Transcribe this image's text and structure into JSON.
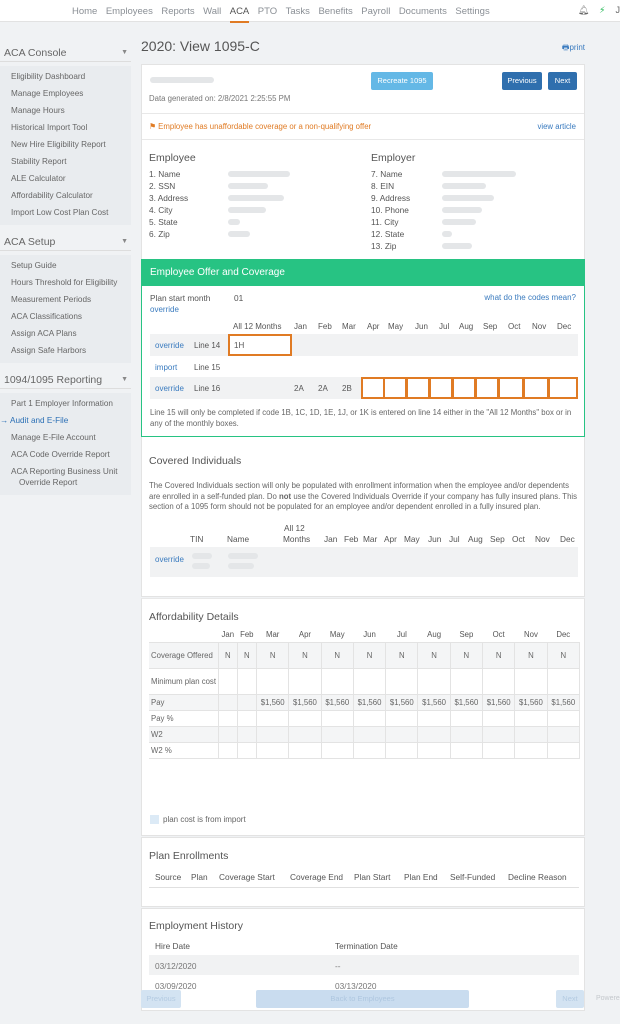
{
  "nav": {
    "items": [
      "Home",
      "Employees",
      "Reports",
      "Wall",
      "ACA",
      "PTO",
      "Tasks",
      "Benefits",
      "Payroll",
      "Documents",
      "Settings"
    ],
    "active": "ACA",
    "user_initial": "J"
  },
  "sidebar": {
    "console": {
      "title": "ACA Console",
      "items": [
        "Eligibility Dashboard",
        "Manage Employees",
        "Manage Hours",
        "Historical Import Tool",
        "New Hire Eligibility Report",
        "Stability Report",
        "ALE Calculator",
        "Affordability Calculator",
        "Import Low Cost Plan Cost"
      ]
    },
    "setup": {
      "title": "ACA Setup",
      "items": [
        "Setup Guide",
        "Hours Threshold for Eligibility",
        "Measurement Periods",
        "ACA Classifications",
        "Assign ACA Plans",
        "Assign Safe Harbors"
      ]
    },
    "reporting": {
      "title": "1094/1095 Reporting",
      "items": [
        "Part 1 Employer Information",
        "Audit and E-File",
        "Manage E-File Account",
        "ACA Code Override Report",
        "ACA Reporting Business Unit",
        "Override Report"
      ],
      "current": "Audit and E-File"
    }
  },
  "page": {
    "title": "2020: View 1095-C",
    "print": "print",
    "generated": "Data generated on: 2/8/2021 2:25:55 PM",
    "buttons": {
      "recreate": "Recreate 1095",
      "previous": "Previous",
      "next": "Next"
    },
    "warning": "Employee has unaffordable coverage or a non-qualifying offer",
    "view_article": "view article"
  },
  "employee": {
    "title": "Employee",
    "fields": [
      "1. Name",
      "2. SSN",
      "3. Address",
      "4. City",
      "5. State",
      "6. Zip"
    ]
  },
  "employer": {
    "title": "Employer",
    "fields": [
      "7. Name",
      "8. EIN",
      "9. Address",
      "10. Phone",
      "11. City",
      "12. State",
      "13. Zip"
    ]
  },
  "offer": {
    "title": "Employee Offer and Coverage",
    "plan_start_label": "Plan start month",
    "plan_start_value": "01",
    "override": "override",
    "codes_link": "what do the codes mean?",
    "all12": "All 12 Months",
    "months": [
      "Jan",
      "Feb",
      "Mar",
      "Apr",
      "May",
      "Jun",
      "Jul",
      "Aug",
      "Sep",
      "Oct",
      "Nov",
      "Dec"
    ],
    "rows": [
      {
        "action": "override",
        "line": "Line 14",
        "all12": "1H",
        "values": [
          "",
          "",
          "",
          "",
          "",
          "",
          "",
          "",
          "",
          "",
          "",
          ""
        ]
      },
      {
        "action": "import",
        "line": "Line 15",
        "all12": "",
        "values": [
          "",
          "",
          "",
          "",
          "",
          "",
          "",
          "",
          "",
          "",
          "",
          ""
        ]
      },
      {
        "action": "override",
        "line": "Line 16",
        "all12": "",
        "values": [
          "2A",
          "2A",
          "2B",
          "",
          "",
          "",
          "",
          "",
          "",
          "",
          "",
          ""
        ]
      }
    ],
    "note": "Line 15 will only be completed if code 1B, 1C, 1D, 1E, 1J, or 1K is entered on line 14 either in the \"All 12 Months\" box or in any of the monthly boxes."
  },
  "covered": {
    "title": "Covered Individuals",
    "desc_a": "The Covered Individuals section will only be populated with enrollment information when the employee and/or dependents are enrolled in a self-funded plan. Do ",
    "desc_not": "not",
    "desc_b": " use the Covered Individuals Override if your company has fully insured plans. This section of a 1095 form should not be populated for an employee and/or dependent enrolled in a fully insured plan.",
    "headers": {
      "tin": "TIN",
      "name": "Name",
      "all12_a": "All 12",
      "all12_b": "Months"
    },
    "override": "override"
  },
  "affordability": {
    "title": "Affordability Details",
    "months": [
      "Jan",
      "Feb",
      "Mar",
      "Apr",
      "May",
      "Jun",
      "Jul",
      "Aug",
      "Sep",
      "Oct",
      "Nov",
      "Dec"
    ],
    "rows": [
      {
        "label": "Coverage Offered",
        "values": [
          "N",
          "N",
          "N",
          "N",
          "N",
          "N",
          "N",
          "N",
          "N",
          "N",
          "N",
          "N"
        ]
      },
      {
        "label": "Minimum plan cost",
        "values": [
          "",
          "",
          "",
          "",
          "",
          "",
          "",
          "",
          "",
          "",
          "",
          ""
        ]
      },
      {
        "label": "Pay",
        "values": [
          "",
          "",
          "$1,560",
          "$1,560",
          "$1,560",
          "$1,560",
          "$1,560",
          "$1,560",
          "$1,560",
          "$1,560",
          "$1,560",
          "$1,560"
        ]
      },
      {
        "label": "Pay %",
        "values": [
          "",
          "",
          "",
          "",
          "",
          "",
          "",
          "",
          "",
          "",
          "",
          ""
        ]
      },
      {
        "label": "W2",
        "values": [
          "",
          "",
          "",
          "",
          "",
          "",
          "",
          "",
          "",
          "",
          "",
          ""
        ]
      },
      {
        "label": "W2 %",
        "values": [
          "",
          "",
          "",
          "",
          "",
          "",
          "",
          "",
          "",
          "",
          "",
          ""
        ]
      }
    ],
    "legend": "plan cost is from import"
  },
  "enrollments": {
    "title": "Plan Enrollments",
    "headers": [
      "Source",
      "Plan",
      "Coverage Start",
      "Coverage End",
      "Plan Start",
      "Plan End",
      "Self-Funded",
      "Decline Reason"
    ]
  },
  "employment": {
    "title": "Employment History",
    "headers": {
      "hire": "Hire Date",
      "term": "Termination Date"
    },
    "rows": [
      {
        "hire": "03/12/2020",
        "term": "--"
      },
      {
        "hire": "03/09/2020",
        "term": "03/13/2020"
      }
    ]
  },
  "footer": {
    "previous": "Previous",
    "back": "Back to Employees",
    "next": "Next",
    "powered": "Powere"
  },
  "colors": {
    "accent": "#e07b24",
    "green": "#27c383",
    "link": "#3a7bbf",
    "button": "#2f6fae"
  }
}
